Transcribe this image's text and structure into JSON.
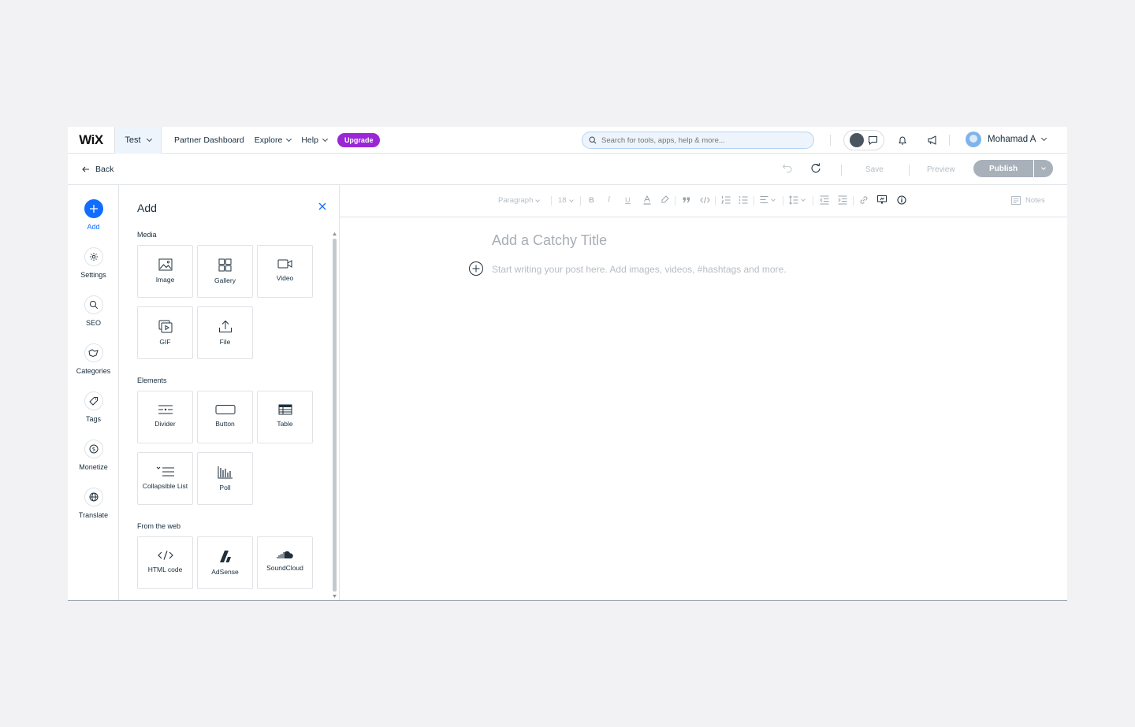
{
  "topbar": {
    "logo": "WiX",
    "site_name": "Test",
    "nav": {
      "partner_dashboard": "Partner Dashboard",
      "explore": "Explore",
      "help": "Help",
      "upgrade": "Upgrade"
    },
    "search_placeholder": "Search for tools, apps, help & more...",
    "user_name": "Mohamad A"
  },
  "subbar": {
    "back": "Back",
    "save": "Save",
    "preview": "Preview",
    "publish": "Publish"
  },
  "rail": {
    "items": [
      {
        "label": "Add",
        "icon": "plus-icon",
        "active": true
      },
      {
        "label": "Settings",
        "icon": "gear-icon"
      },
      {
        "label": "SEO",
        "icon": "search-icon"
      },
      {
        "label": "Categories",
        "icon": "categories-icon"
      },
      {
        "label": "Tags",
        "icon": "tag-icon"
      },
      {
        "label": "Monetize",
        "icon": "dollar-icon"
      },
      {
        "label": "Translate",
        "icon": "globe-icon"
      }
    ]
  },
  "panel": {
    "title": "Add",
    "sections": {
      "media": "Media",
      "elements": "Elements",
      "web": "From the web"
    },
    "tiles": {
      "image": "Image",
      "gallery": "Gallery",
      "video": "Video",
      "gif": "GIF",
      "file": "File",
      "divider": "Divider",
      "button": "Button",
      "table": "Table",
      "collapsible": "Collapsible List",
      "poll": "Poll",
      "html": "HTML code",
      "adsense": "AdSense",
      "soundcloud": "SoundCloud"
    }
  },
  "editor": {
    "toolbar": {
      "paragraph": "Paragraph",
      "font_size": "18",
      "notes": "Notes"
    },
    "title_placeholder": "Add a Catchy Title",
    "body_placeholder": "Start writing your post here. Add images, videos, #hashtags and more."
  },
  "colors": {
    "accent": "#116dff",
    "upgrade": "#9a27d5",
    "publish_disabled": "#a8b1ba"
  }
}
